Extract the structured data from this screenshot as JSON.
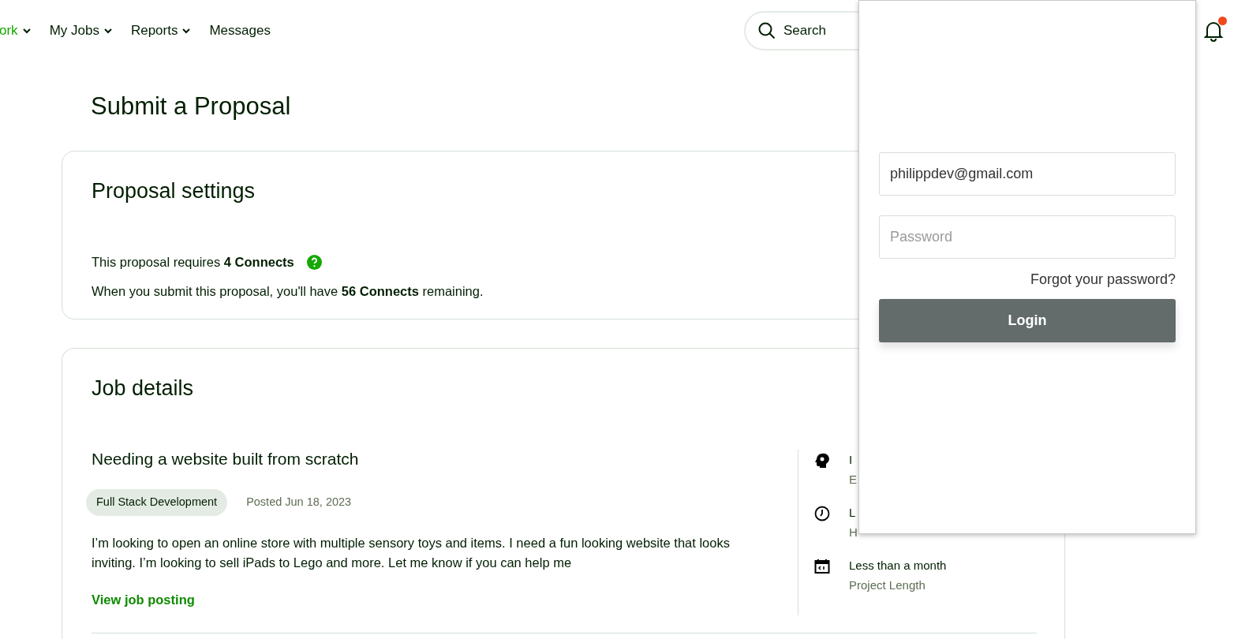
{
  "nav": [
    {
      "label": "ork",
      "selected": true,
      "dropdown": true
    },
    {
      "label": "My Jobs",
      "selected": false,
      "dropdown": true
    },
    {
      "label": "Reports",
      "selected": false,
      "dropdown": true
    },
    {
      "label": "Messages",
      "selected": false,
      "dropdown": false
    }
  ],
  "search": {
    "placeholder": "Search"
  },
  "notifications": {
    "unread": true
  },
  "page_title": "Submit a Proposal",
  "proposal_settings": {
    "title": "Proposal settings",
    "requires": "This proposal requires **4 Connects**",
    "remaining": "When you submit this proposal, you'll have **56 Connects** remaining."
  },
  "job_details": {
    "title": "Job details",
    "job_title": "Needing a website built from scratch",
    "tag": "Full Stack Development",
    "posted": "Posted Jun 18, 2023",
    "description": "I’m looking to open an online store with multiple sensory toys and items. I need a fun looking website that looks inviting. I’m looking to sell iPads to Lego and more. Let me know if you can help me",
    "link": "View job posting",
    "facts": [
      {
        "kind": "level",
        "value": "I",
        "label": "E"
      },
      {
        "kind": "hours",
        "value": "L",
        "label": "H"
      },
      {
        "kind": "duration",
        "value": "Less than a month",
        "label": "Project Length"
      }
    ]
  },
  "login": {
    "email": "philippdev@gmail.com",
    "password_placeholder": "Password",
    "forgot": "Forgot your password?",
    "button": "Login"
  }
}
